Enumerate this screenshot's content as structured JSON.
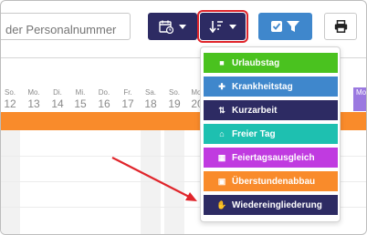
{
  "search": {
    "placeholder": "der Personalnummer"
  },
  "toolbar": {
    "calendar_icon": "calendar-clock-icon",
    "sort_icon": "sort-descending-icon",
    "filter_icon": "checkbox-filter-icon",
    "print_icon": "printer-icon"
  },
  "calendar": {
    "days": [
      {
        "name": "So.",
        "date": "12"
      },
      {
        "name": "Mo.",
        "date": "13"
      },
      {
        "name": "Di.",
        "date": "14"
      },
      {
        "name": "Mi.",
        "date": "15"
      },
      {
        "name": "Do.",
        "date": "16"
      },
      {
        "name": "Fr.",
        "date": "17"
      },
      {
        "name": "Sa.",
        "date": "18"
      },
      {
        "name": "So.",
        "date": "19"
      },
      {
        "name": "Mo.",
        "date": "20"
      }
    ],
    "highlight_day": "Mo"
  },
  "menu": {
    "items": [
      {
        "label": "Urlaubstag",
        "icon": "suitcase-icon",
        "glyph": "🧳",
        "color": "#4ac21f"
      },
      {
        "label": "Krankheitstag",
        "icon": "medkit-icon",
        "glyph": "✚",
        "color": "#3f87cc"
      },
      {
        "label": "Kurzarbeit",
        "icon": "sort-icon",
        "glyph": "⇅",
        "color": "#2d2b63"
      },
      {
        "label": "Freier Tag",
        "icon": "home-icon",
        "glyph": "⌂",
        "color": "#1ec0b0"
      },
      {
        "label": "Feiertagsausgleich",
        "icon": "calendar-icon",
        "glyph": "▦",
        "color": "#c03be0"
      },
      {
        "label": "Überstundenabbau",
        "icon": "calendar-minus-icon",
        "glyph": "▣",
        "color": "#f98b2b"
      },
      {
        "label": "Wiedereingliederung",
        "icon": "handshake-icon",
        "glyph": "✋",
        "color": "#2d2b63"
      }
    ]
  },
  "colors": {
    "orange": "#f98b2b",
    "navy": "#2d2b63",
    "blue": "#3f87cc",
    "red_arrow": "#e0252b"
  }
}
